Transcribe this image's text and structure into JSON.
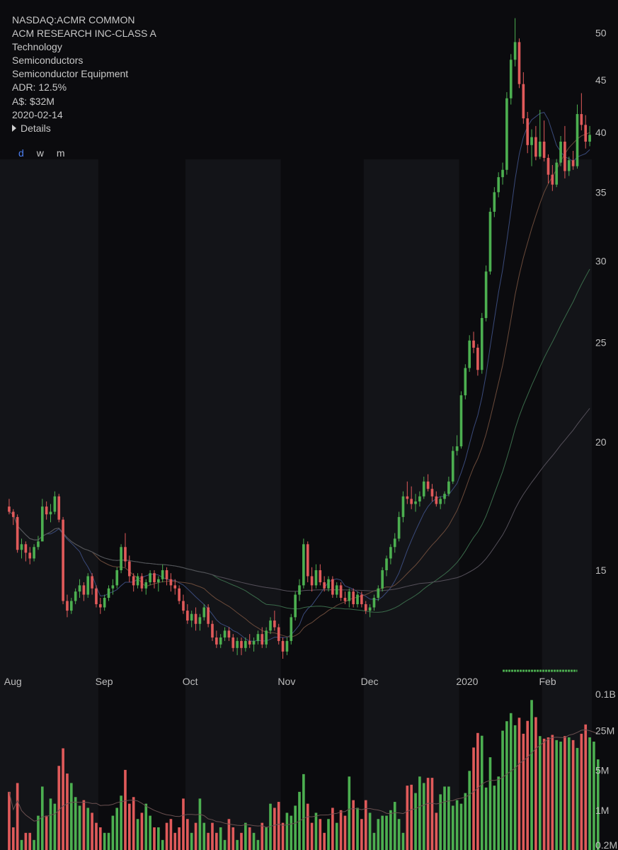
{
  "header": {
    "symbol_line": "NASDAQ:ACMR COMMON",
    "company": "ACM RESEARCH INC-CLASS A",
    "sector": "Technology",
    "industry": "Semiconductors",
    "sub_industry": "Semiconductor Equipment",
    "adr": "ADR: 12.5%",
    "dollar_volume": "A$: $32M",
    "date": "2020-02-14",
    "details_label": "Details"
  },
  "timeframes": [
    {
      "label": "d",
      "active": true
    },
    {
      "label": "w",
      "active": false
    },
    {
      "label": "m",
      "active": false
    }
  ],
  "colors": {
    "background": "#0b0b0e",
    "band": "#131418",
    "up": "#4caf50",
    "down": "#e05a5a",
    "axis_text": "#bdbdbd",
    "active_tf": "#4c7ff0"
  },
  "chart_data": [
    {
      "type": "candlestick",
      "title": "",
      "price_axis": {
        "ticks": [
          "15",
          "20",
          "25",
          "30",
          "35",
          "40",
          "45",
          "50"
        ],
        "scale": "log",
        "range": [
          12.3,
          52
        ]
      },
      "x_axis": {
        "labels": [
          "Aug",
          "Sep",
          "Oct",
          "Nov",
          "Dec",
          "2020",
          "Feb"
        ],
        "label_bar_index": [
          1,
          23,
          44,
          67,
          87,
          110,
          130
        ]
      },
      "moving_averages": [
        "MA-fast",
        "MA-mid",
        "MA-slow",
        "MA-long"
      ],
      "ohlc": [
        [
          17.3,
          17.6,
          17.0,
          17.1
        ],
        [
          17.1,
          17.2,
          16.6,
          16.9
        ],
        [
          16.9,
          17.0,
          15.6,
          15.7
        ],
        [
          15.7,
          16.1,
          15.4,
          15.9
        ],
        [
          15.9,
          16.0,
          15.3,
          15.6
        ],
        [
          15.6,
          15.8,
          15.2,
          15.4
        ],
        [
          15.4,
          15.9,
          15.3,
          15.8
        ],
        [
          15.8,
          16.2,
          15.7,
          16.0
        ],
        [
          16.0,
          17.6,
          16.0,
          17.3
        ],
        [
          17.3,
          17.5,
          16.8,
          17.0
        ],
        [
          17.0,
          17.4,
          16.7,
          17.1
        ],
        [
          17.1,
          17.9,
          17.0,
          17.7
        ],
        [
          17.7,
          17.8,
          16.7,
          16.8
        ],
        [
          16.8,
          16.9,
          13.9,
          14.0
        ],
        [
          14.0,
          14.2,
          13.5,
          13.7
        ],
        [
          13.7,
          14.1,
          13.6,
          14.0
        ],
        [
          14.0,
          14.4,
          13.9,
          14.3
        ],
        [
          14.3,
          14.7,
          14.1,
          14.5
        ],
        [
          14.5,
          14.6,
          14.0,
          14.2
        ],
        [
          14.2,
          14.9,
          14.1,
          14.8
        ],
        [
          14.8,
          14.9,
          14.2,
          14.4
        ],
        [
          14.4,
          14.5,
          13.8,
          13.9
        ],
        [
          13.9,
          14.1,
          13.6,
          13.8
        ],
        [
          13.8,
          14.2,
          13.7,
          14.1
        ],
        [
          14.1,
          14.5,
          14.0,
          14.4
        ],
        [
          14.4,
          14.7,
          14.2,
          14.5
        ],
        [
          14.5,
          15.1,
          14.4,
          15.0
        ],
        [
          15.0,
          15.9,
          14.9,
          15.8
        ],
        [
          15.8,
          16.3,
          15.1,
          15.3
        ],
        [
          15.3,
          15.5,
          14.6,
          14.8
        ],
        [
          14.8,
          14.9,
          14.3,
          14.5
        ],
        [
          14.5,
          14.9,
          14.4,
          14.8
        ],
        [
          14.8,
          14.9,
          14.3,
          14.4
        ],
        [
          14.4,
          14.7,
          14.2,
          14.6
        ],
        [
          14.6,
          15.0,
          14.5,
          14.9
        ],
        [
          14.9,
          15.0,
          14.4,
          14.6
        ],
        [
          14.6,
          14.8,
          14.3,
          14.7
        ],
        [
          14.7,
          15.2,
          14.6,
          15.0
        ],
        [
          15.0,
          15.1,
          14.5,
          14.7
        ],
        [
          14.7,
          14.9,
          14.3,
          14.5
        ],
        [
          14.5,
          14.7,
          14.2,
          14.4
        ],
        [
          14.4,
          14.5,
          13.9,
          14.0
        ],
        [
          14.0,
          14.2,
          13.6,
          13.7
        ],
        [
          13.7,
          13.9,
          13.3,
          13.4
        ],
        [
          13.4,
          13.7,
          13.2,
          13.6
        ],
        [
          13.6,
          13.8,
          13.1,
          13.3
        ],
        [
          13.3,
          13.6,
          13.1,
          13.5
        ],
        [
          13.5,
          13.9,
          13.4,
          13.8
        ],
        [
          13.8,
          13.9,
          13.2,
          13.3
        ],
        [
          13.3,
          13.4,
          12.8,
          12.9
        ],
        [
          12.9,
          13.1,
          12.6,
          12.7
        ],
        [
          12.7,
          13.0,
          12.6,
          12.9
        ],
        [
          12.9,
          13.2,
          12.8,
          13.1
        ],
        [
          13.1,
          13.2,
          12.8,
          12.9
        ],
        [
          12.9,
          13.0,
          12.5,
          12.6
        ],
        [
          12.6,
          12.9,
          12.4,
          12.8
        ],
        [
          12.8,
          12.9,
          12.4,
          12.6
        ],
        [
          12.6,
          12.9,
          12.5,
          12.8
        ],
        [
          12.8,
          13.0,
          12.6,
          12.7
        ],
        [
          12.7,
          12.9,
          12.5,
          12.8
        ],
        [
          12.8,
          13.1,
          12.7,
          13.0
        ],
        [
          13.0,
          13.2,
          12.6,
          12.7
        ],
        [
          12.7,
          13.2,
          12.6,
          13.1
        ],
        [
          13.1,
          13.5,
          13.0,
          13.4
        ],
        [
          13.4,
          13.7,
          13.1,
          13.2
        ],
        [
          13.2,
          13.3,
          12.7,
          12.8
        ],
        [
          12.8,
          12.9,
          12.3,
          12.5
        ],
        [
          12.5,
          12.9,
          12.4,
          12.8
        ],
        [
          12.8,
          13.6,
          12.7,
          13.5
        ],
        [
          13.5,
          14.3,
          13.4,
          14.2
        ],
        [
          14.2,
          14.7,
          14.0,
          14.5
        ],
        [
          14.5,
          16.1,
          14.4,
          15.9
        ],
        [
          15.9,
          16.0,
          14.6,
          14.8
        ],
        [
          14.8,
          15.1,
          14.3,
          14.5
        ],
        [
          14.5,
          15.2,
          14.4,
          15.0
        ],
        [
          15.0,
          15.2,
          14.5,
          14.6
        ],
        [
          14.6,
          14.8,
          14.3,
          14.4
        ],
        [
          14.4,
          14.8,
          14.3,
          14.7
        ],
        [
          14.7,
          14.8,
          14.1,
          14.2
        ],
        [
          14.2,
          14.6,
          14.1,
          14.5
        ],
        [
          14.5,
          14.6,
          14.0,
          14.1
        ],
        [
          14.1,
          14.3,
          13.9,
          14.0
        ],
        [
          14.0,
          14.4,
          13.8,
          14.3
        ],
        [
          14.3,
          14.4,
          13.8,
          13.9
        ],
        [
          13.9,
          14.3,
          13.8,
          14.2
        ],
        [
          14.2,
          14.3,
          13.8,
          13.9
        ],
        [
          13.9,
          14.0,
          13.6,
          13.7
        ],
        [
          13.7,
          13.9,
          13.5,
          13.8
        ],
        [
          13.8,
          14.2,
          13.7,
          14.1
        ],
        [
          14.1,
          14.5,
          14.0,
          14.4
        ],
        [
          14.4,
          15.1,
          14.3,
          15.0
        ],
        [
          15.0,
          15.5,
          14.8,
          15.4
        ],
        [
          15.4,
          15.9,
          15.2,
          15.8
        ],
        [
          15.8,
          16.3,
          15.6,
          16.1
        ],
        [
          16.1,
          17.1,
          16.0,
          16.9
        ],
        [
          16.9,
          17.9,
          16.7,
          17.7
        ],
        [
          17.7,
          18.3,
          17.4,
          17.6
        ],
        [
          17.6,
          18.1,
          17.2,
          17.4
        ],
        [
          17.4,
          17.8,
          17.1,
          17.5
        ],
        [
          17.5,
          17.9,
          17.3,
          17.7
        ],
        [
          17.7,
          18.5,
          17.6,
          18.3
        ],
        [
          18.3,
          18.6,
          17.9,
          18.0
        ],
        [
          18.0,
          18.2,
          17.5,
          17.7
        ],
        [
          17.7,
          17.9,
          17.3,
          17.4
        ],
        [
          17.4,
          17.7,
          17.2,
          17.6
        ],
        [
          17.6,
          17.9,
          17.4,
          17.8
        ],
        [
          17.8,
          18.5,
          17.7,
          18.3
        ],
        [
          18.3,
          19.8,
          18.2,
          19.6
        ],
        [
          19.6,
          20.3,
          19.4,
          19.8
        ],
        [
          19.8,
          22.4,
          19.7,
          22.2
        ],
        [
          22.2,
          23.8,
          22.0,
          23.6
        ],
        [
          23.6,
          25.4,
          23.4,
          25.1
        ],
        [
          25.1,
          25.6,
          24.4,
          24.7
        ],
        [
          24.7,
          24.9,
          23.2,
          23.5
        ],
        [
          23.5,
          26.7,
          23.3,
          26.4
        ],
        [
          26.4,
          29.7,
          26.2,
          29.3
        ],
        [
          29.3,
          33.8,
          29.1,
          33.5
        ],
        [
          33.5,
          35.4,
          33.1,
          35.0
        ],
        [
          35.0,
          36.6,
          34.6,
          36.2
        ],
        [
          36.2,
          37.4,
          35.6,
          36.8
        ],
        [
          36.8,
          43.8,
          36.4,
          43.2
        ],
        [
          43.2,
          47.7,
          42.6,
          47.1
        ],
        [
          47.1,
          51.7,
          46.4,
          49.0
        ],
        [
          49.0,
          49.4,
          44.2,
          44.6
        ],
        [
          44.6,
          45.8,
          40.8,
          41.3
        ],
        [
          41.3,
          41.9,
          38.2,
          38.9
        ],
        [
          38.9,
          40.3,
          37.1,
          39.6
        ],
        [
          39.6,
          40.6,
          37.6,
          37.9
        ],
        [
          37.9,
          42.1,
          37.7,
          39.2
        ],
        [
          39.2,
          41.1,
          37.5,
          37.8
        ],
        [
          37.8,
          38.1,
          35.7,
          36.4
        ],
        [
          36.4,
          37.2,
          35.1,
          35.6
        ],
        [
          35.6,
          37.7,
          35.4,
          37.4
        ],
        [
          37.4,
          39.7,
          37.1,
          39.2
        ],
        [
          39.2,
          40.6,
          36.1,
          36.7
        ],
        [
          36.7,
          37.9,
          36.3,
          37.6
        ],
        [
          37.6,
          38.4,
          36.8,
          37.1
        ],
        [
          37.1,
          42.6,
          36.9,
          41.7
        ],
        [
          41.7,
          43.7,
          40.2,
          40.7
        ],
        [
          40.7,
          41.6,
          38.6,
          39.2
        ],
        [
          39.2,
          40.6,
          38.8,
          39.8
        ]
      ]
    },
    {
      "type": "bar",
      "title": "",
      "y_axis": {
        "ticks": [
          "0.1B",
          "25M",
          "5M",
          "1M",
          "0.2M"
        ],
        "scale": "log"
      },
      "values": [
        2.1,
        0.5,
        3.0,
        0.3,
        0.4,
        0.4,
        0.3,
        0.8,
        2.6,
        0.8,
        1.6,
        1.3,
        6.0,
        12.2,
        4.4,
        3.0,
        1.7,
        1.2,
        1.5,
        1.1,
        0.9,
        0.6,
        0.5,
        0.4,
        0.4,
        0.8,
        1.1,
        1.8,
        5.1,
        1.3,
        1.7,
        0.7,
        0.9,
        1.3,
        0.8,
        0.5,
        0.5,
        0.3,
        0.6,
        0.7,
        0.4,
        0.5,
        1.6,
        0.7,
        0.4,
        0.6,
        1.6,
        0.6,
        0.4,
        0.6,
        0.4,
        0.5,
        0.3,
        0.7,
        0.5,
        0.3,
        0.4,
        0.6,
        0.5,
        0.4,
        0.3,
        0.6,
        0.5,
        1.3,
        1.1,
        1.4,
        0.6,
        0.9,
        0.8,
        1.2,
        2.1,
        4.3,
        1.3,
        0.6,
        0.9,
        0.7,
        0.4,
        0.7,
        1.1,
        0.6,
        1.0,
        0.8,
        3.9,
        1.5,
        1.1,
        0.7,
        1.5,
        0.9,
        0.4,
        0.7,
        0.8,
        0.8,
        1.0,
        1.4,
        0.7,
        0.4,
        2.7,
        2.8,
        2.0,
        3.9,
        3.0,
        3.7,
        3.7,
        0.9,
        1.9,
        2.6,
        2.6,
        1.2,
        1.5,
        1.3,
        2.0,
        4.9,
        12.6,
        22.7,
        20.3,
        2.5,
        8.5,
        2.7,
        3.9,
        24.9,
        36.5,
        50.6,
        31.0,
        42.0,
        22.0,
        37.0,
        86.0,
        43.0,
        20.0,
        18.0,
        19.0,
        21.0,
        17.0,
        16.0,
        20.0,
        19.0,
        17.0,
        12.4,
        22.0,
        32.0,
        19.0,
        16.0,
        7.8
      ],
      "marker_label": ""
    }
  ]
}
